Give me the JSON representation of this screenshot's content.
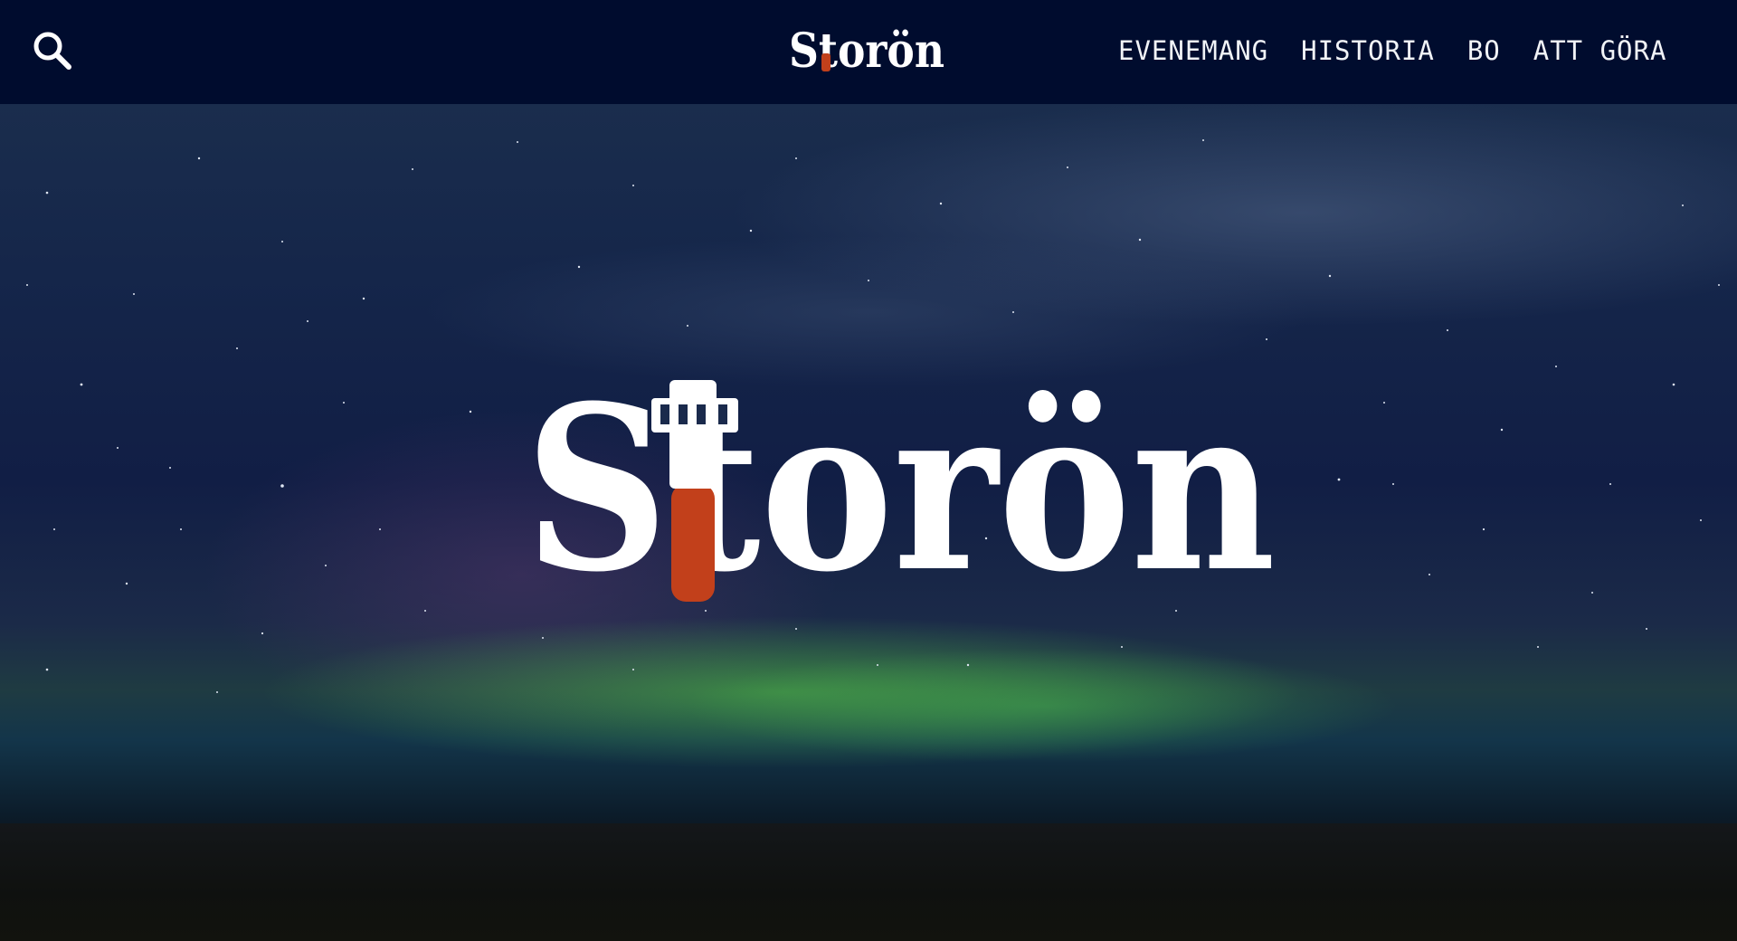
{
  "header": {
    "brand": "Storön",
    "search_icon": "search-icon",
    "nav": [
      {
        "label": "EVENEMANG"
      },
      {
        "label": "HISTORIA"
      },
      {
        "label": "BO"
      },
      {
        "label": "ATT GÖRA"
      }
    ]
  },
  "hero": {
    "brand": "Storön",
    "background": "northern-lights-night-sky"
  },
  "colors": {
    "header_bg": "#000c2e",
    "logo_text": "#ffffff",
    "lighthouse_accent": "#c2401b",
    "nav_text": "#f1f3f7"
  }
}
